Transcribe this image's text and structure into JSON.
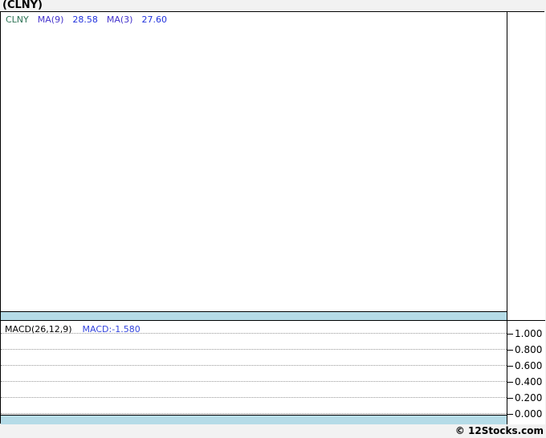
{
  "title": "(CLNY)",
  "main_panel": {
    "legend": {
      "symbol": "CLNY",
      "ma9_label": "MA(9)",
      "ma9_value": "28.58",
      "ma3_label": "MA(3)",
      "ma3_value": "27.60"
    }
  },
  "macd_panel": {
    "label": "MACD(26,12,9)",
    "value_label": "MACD:-1.580"
  },
  "axis": {
    "labels": [
      "1.000",
      "0.800",
      "0.600",
      "0.400",
      "0.200",
      "0.000"
    ]
  },
  "footer": "© 12Stocks.com",
  "colors": {
    "page_background": "#f2f2f2",
    "panel_background": "#ffffff",
    "border": "#000000",
    "band_blue": "#b5dbe7",
    "symbol_green": "#2d7355",
    "ma_label_purple": "#4433cc",
    "ma_value_blue": "#2233dd",
    "macd_value_blue": "#3344dd",
    "gridline_gray": "#999999"
  },
  "chart_data": [
    {
      "type": "line",
      "panel": "price",
      "title": "(CLNY)",
      "legend": [
        "CLNY",
        "MA(9) 28.58",
        "MA(3) 27.60"
      ],
      "series": [
        {
          "name": "CLNY",
          "values": []
        },
        {
          "name": "MA(9)",
          "last_value": 28.58,
          "values": []
        },
        {
          "name": "MA(3)",
          "last_value": 27.6,
          "values": []
        }
      ],
      "grid": false,
      "note": "panel rendered empty — no price data plotted in screenshot"
    },
    {
      "type": "line",
      "panel": "MACD(26,12,9)",
      "legend": [
        "MACD:-1.580"
      ],
      "series": [
        {
          "name": "MACD",
          "last_value": -1.58,
          "values": []
        }
      ],
      "ylim": [
        0.0,
        1.0
      ],
      "yticks": [
        1.0,
        0.8,
        0.6,
        0.4,
        0.2,
        0.0
      ],
      "grid": true,
      "legend_position": "top-left",
      "note": "panel rendered empty — only dotted gridlines visible"
    }
  ]
}
